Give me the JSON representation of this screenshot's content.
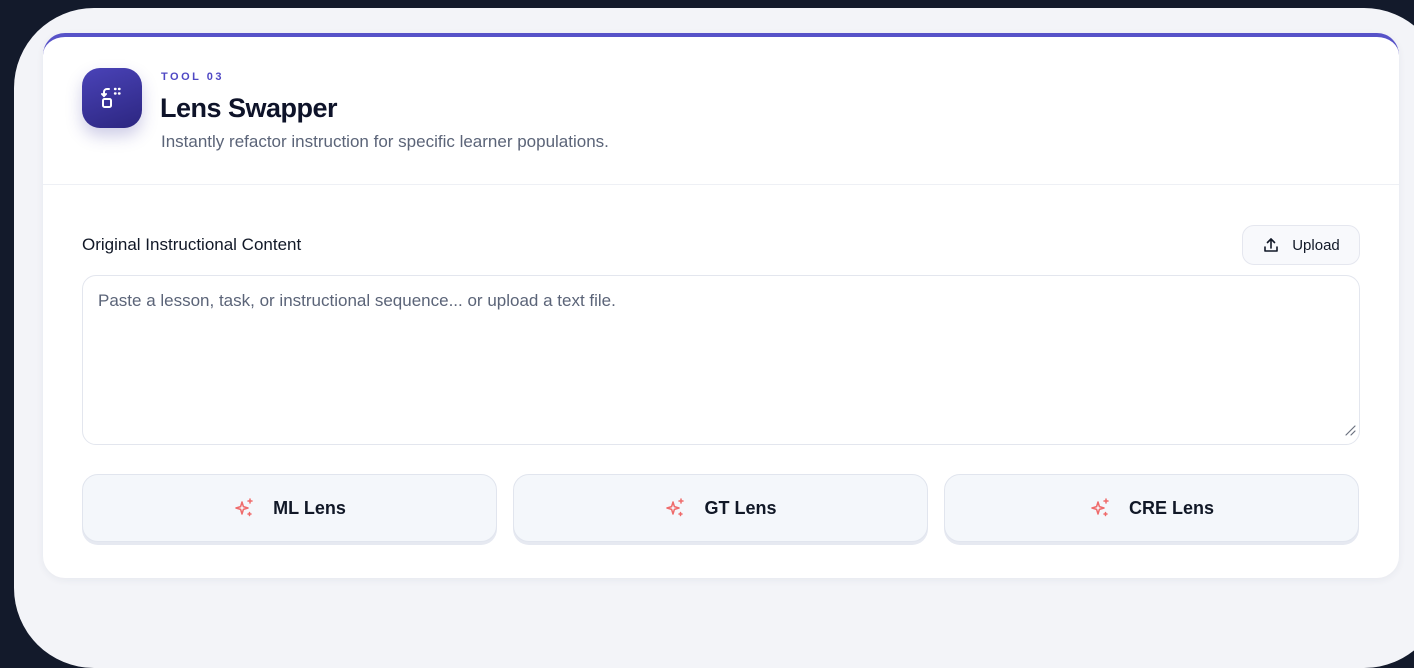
{
  "tool": {
    "tag": "TOOL 03",
    "title": "Lens Swapper",
    "subtitle": "Instantly refactor instruction for specific learner populations.",
    "icon": "lens-swap-icon"
  },
  "content": {
    "label": "Original Instructional Content",
    "upload_label": "Upload",
    "upload_icon": "upload-icon",
    "placeholder": "Paste a lesson, task, or instructional sequence... or upload a text file.",
    "value": ""
  },
  "lenses": [
    {
      "label": "ML Lens",
      "icon": "sparkles-icon"
    },
    {
      "label": "GT Lens",
      "icon": "sparkles-icon"
    },
    {
      "label": "CRE Lens",
      "icon": "sparkles-icon"
    }
  ],
  "colors": {
    "accent": "#5752c8",
    "page_bg": "#131a2b",
    "spark": "#ef6b6b"
  }
}
